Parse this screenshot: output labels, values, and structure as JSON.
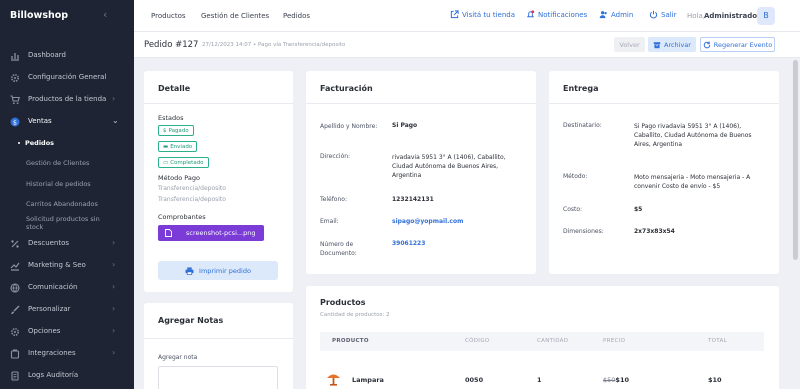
{
  "brand": "Billowshop",
  "sidebar": {
    "items": [
      {
        "label": "Dashboard",
        "icon": "chart-icon"
      },
      {
        "label": "Configuración General",
        "icon": "gear-icon"
      },
      {
        "label": "Productos de la tienda",
        "icon": "cart-icon"
      },
      {
        "label": "Ventas",
        "icon": "dollar-icon"
      },
      {
        "label": "Descuentos",
        "icon": "percent-icon"
      },
      {
        "label": "Marketing & Seo",
        "icon": "chart-line-icon"
      },
      {
        "label": "Comunicación",
        "icon": "globe-icon"
      },
      {
        "label": "Personalizar",
        "icon": "brush-icon"
      },
      {
        "label": "Opciones",
        "icon": "gear-icon"
      },
      {
        "label": "Integraciones",
        "icon": "puzzle-icon"
      },
      {
        "label": "Logs Auditoría",
        "icon": "log-icon"
      }
    ],
    "ventas_sub": [
      "Pedidos",
      "Gestión de Clientes",
      "Historial de pedidos",
      "Carritos Abandonados",
      "Solicitud productos sin",
      "stock"
    ]
  },
  "topbar": {
    "links": [
      "Productos",
      "Gestión de Clientes",
      "Pedidos"
    ],
    "visit_store": "Visitá tu tienda",
    "notifications": "Notificaciones",
    "admin": "Admin",
    "logout": "Salir",
    "greeting": "Hola,",
    "user": "Administrador",
    "avatar": "B"
  },
  "header": {
    "title": "Pedido #127",
    "meta": "27/12/2023 14:07  •  Pago vía Transferencia/deposito",
    "buttons": {
      "back": "Volver",
      "archive": "Archivar",
      "regenerate": "Regenerar Evento"
    }
  },
  "detalle": {
    "title": "Detalle",
    "estados_label": "Estados",
    "states": [
      "Pagado",
      "Enviado",
      "Completado"
    ],
    "payment_label": "Método Pago",
    "payment_values": [
      "Transferencia/deposito",
      "Transferencia/deposito"
    ],
    "receipts_label": "Comprobantes",
    "file": "screenshot-pcsi...png",
    "print": "Imprimir pedido"
  },
  "notas": {
    "title": "Agregar Notas",
    "label": "Agregar nota"
  },
  "facturacion": {
    "title": "Facturación",
    "name_label": "Apellido y Nombre:",
    "name": "Si Pago",
    "address_label": "Dirección:",
    "address": "rivadavia 5951 3° A (1406), Caballito, Ciudad Autónoma de Buenos Aires, Argentina",
    "phone_label": "Teléfono:",
    "phone": "1232142131",
    "email_label": "Email:",
    "email": "sipago@yopmail.com",
    "doc_label": "Número de Documento:",
    "doc": "39061223"
  },
  "entrega": {
    "title": "Entrega",
    "dest_label": "Destinatario:",
    "dest": "Si Pago rivadavia 5951 3° A (1406), Caballito, Ciudad Autónoma de Buenos Aires, Argentina",
    "method_label": "Método:",
    "method": "Moto mensajeria - Moto mensajeria - A convenir Costo de envío - $5",
    "cost_label": "Costo:",
    "cost": "$5",
    "dims_label": "Dimensiones:",
    "dims": "2x73x83x54"
  },
  "productos": {
    "title": "Productos",
    "count": "Cantidad de productos: 2",
    "columns": [
      "PRODUCTO",
      "CÓDIGO",
      "CANTIDAD",
      "PRECIO",
      "TOTAL"
    ],
    "rows": [
      {
        "name": "Lampara",
        "code": "0050",
        "qty": "1",
        "old_price": "$50",
        "price": "$10",
        "total": "$10"
      }
    ]
  },
  "colors": {
    "sidebar": "#1e2433",
    "accent": "#2f6fd8",
    "success": "#1f9b78",
    "file_chip": "#7a3bd6"
  }
}
